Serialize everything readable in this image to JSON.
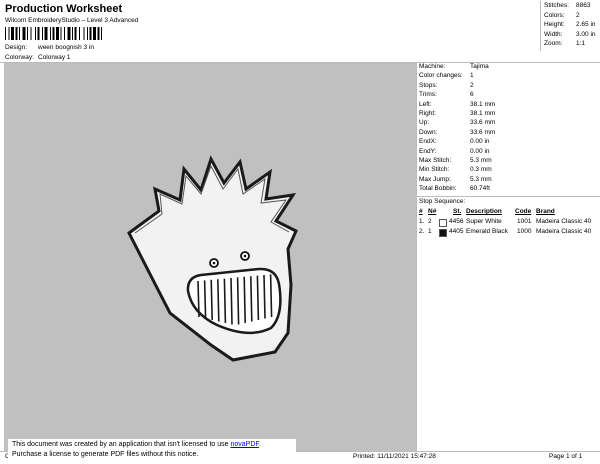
{
  "header": {
    "title": "Production Worksheet",
    "subtitle": "Wilcom EmbroideryStudio – Level 3 Advanced",
    "design_label": "Design:",
    "design_value": "ween boognish 3 in",
    "colorway_label": "Colorway:",
    "colorway_value": "Colorway 1"
  },
  "stats": [
    {
      "label": "Stitches:",
      "value": "8863"
    },
    {
      "label": "Colors:",
      "value": "2"
    },
    {
      "label": "Height:",
      "value": "2.65 in"
    },
    {
      "label": "Width:",
      "value": "3.00 in"
    },
    {
      "label": "Zoom:",
      "value": "1:1"
    }
  ],
  "machine": [
    {
      "label": "Machine:",
      "value": "Tajima"
    },
    {
      "label": "Color changes:",
      "value": "1"
    },
    {
      "label": "Stops:",
      "value": "2"
    },
    {
      "label": "Trims:",
      "value": "6"
    },
    {
      "label": "Left:",
      "value": "38.1 mm"
    },
    {
      "label": "Right:",
      "value": "38.1 mm"
    },
    {
      "label": "Up:",
      "value": "33.6 mm"
    },
    {
      "label": "Down:",
      "value": "33.6 mm"
    },
    {
      "label": "EndX:",
      "value": "0.00 in"
    },
    {
      "label": "EndY:",
      "value": "0.00 in"
    },
    {
      "label": "Max Stitch:",
      "value": "5.3 mm"
    },
    {
      "label": "Min Stitch:",
      "value": "0.3 mm"
    },
    {
      "label": "Max Jump:",
      "value": "5.3 mm"
    },
    {
      "label": "Total Bobbin:",
      "value": "60.74ft"
    }
  ],
  "stop_sequence": {
    "title": "Stop Sequence:",
    "headers": [
      "#",
      "N#",
      "St.",
      "Description",
      "Code",
      "Brand"
    ],
    "rows": [
      {
        "idx": "1.",
        "n": "2",
        "swatch": "#ffffff",
        "st": "4456",
        "desc": "Super White",
        "code": "1001",
        "brand": "Madeira Classic 40"
      },
      {
        "idx": "2.",
        "n": "1",
        "swatch": "#111111",
        "st": "4405",
        "desc": "Emerald Black",
        "code": "1000",
        "brand": "Madeira Classic 40"
      }
    ]
  },
  "notice": {
    "line1_pre": "This document was created by an application that isn't licensed to use ",
    "link": "novaPDF",
    "line1_post": ".",
    "line2": "Purchase a license to generate PDF files without this notice."
  },
  "footer": {
    "left": "Cr",
    "printed": "Printed: 11/11/2021 15:47:28",
    "page": "Page 1 of 1"
  }
}
